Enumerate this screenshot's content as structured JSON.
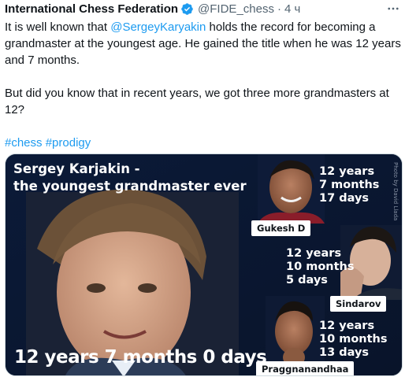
{
  "tweet": {
    "author_name": "International Chess Federation",
    "handle": "@FIDE_chess",
    "separator": "·",
    "time": "4 ч",
    "text_line1_pre": "It is well known that ",
    "mention": "@SergeyKaryakin",
    "text_line1_post": " holds the record for becoming a grandmaster at the youngest age. He gained the title when he was 12 years and 7 months.",
    "text_para2": "But did you know that in recent years, we got three more grandmasters at 12?",
    "hashtag1": "#chess",
    "hashtag2": "#prodigy"
  },
  "image": {
    "headline_line1": "Sergey Karjakin -",
    "headline_line2": "the youngest grandmaster ever",
    "main_caption": "12 years 7 months 0 days",
    "credit": "Photo by David Llada",
    "players": [
      {
        "name": "Gukesh D",
        "years": "12 years",
        "months": "7 months",
        "days": "17 days"
      },
      {
        "name": "Sindarov",
        "years": "12 years",
        "months": "10 months",
        "days": "5 days"
      },
      {
        "name": "Praggnanandhaa",
        "years": "12 years",
        "months": "10 months",
        "days": "13 days"
      }
    ]
  },
  "colors": {
    "link": "#1d9bf0",
    "verified": "#1d9bf0",
    "image_background": "#0c1a33"
  },
  "icons": [
    "verified-badge-icon",
    "more-options-icon"
  ]
}
